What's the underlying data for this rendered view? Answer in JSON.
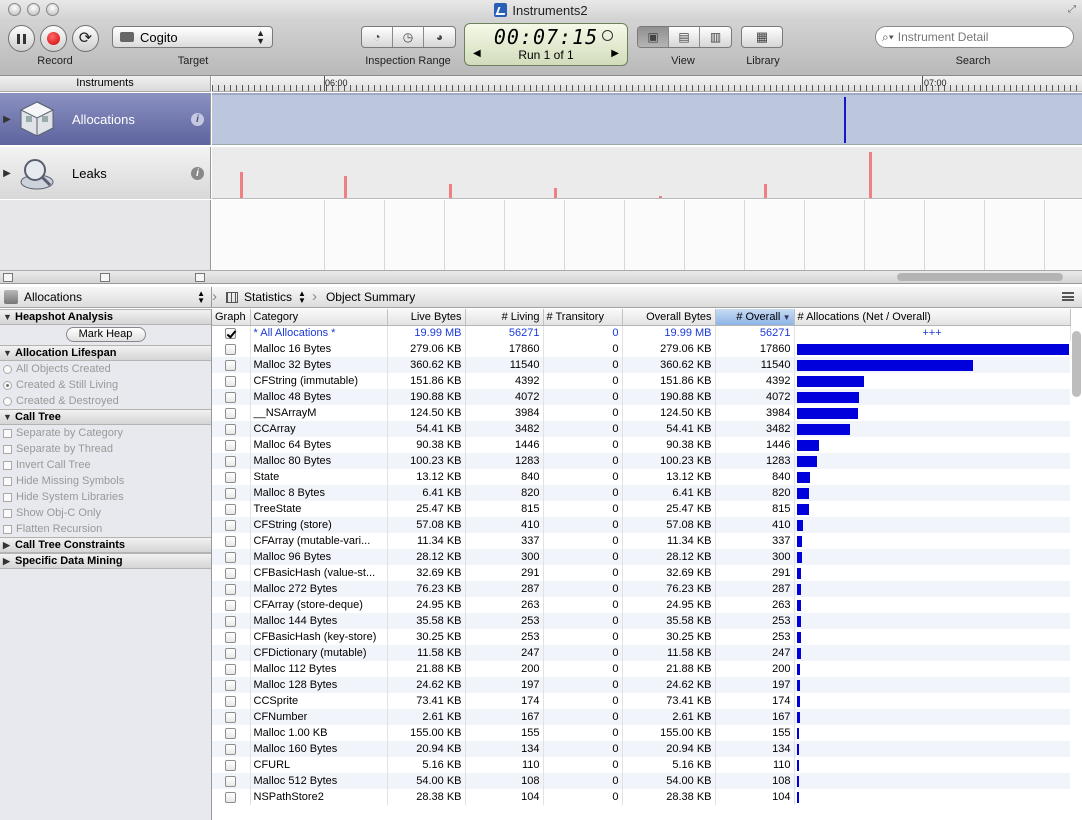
{
  "window": {
    "title": "Instruments2"
  },
  "toolbar": {
    "record_label": "Record",
    "target_label": "Target",
    "target_value": "Cogito",
    "inspection_label": "Inspection Range",
    "timer": "00:07:15",
    "run": "Run 1 of 1",
    "view_label": "View",
    "library_label": "Library",
    "search_label": "Search",
    "search_placeholder": "Instrument Detail"
  },
  "tracks": {
    "header": "Instruments",
    "ruler_labels": [
      "06:00",
      "07:00"
    ],
    "instruments": [
      {
        "name": "Allocations",
        "icon": "allocations-icon"
      },
      {
        "name": "Leaks",
        "icon": "leaks-icon"
      }
    ],
    "leak_spikes": [
      0.55,
      0.45,
      0.3,
      0.2,
      0.05,
      0.3,
      0.95
    ]
  },
  "detail_nav": {
    "instrument": "Allocations",
    "view": "Statistics",
    "breadcrumb": "Object Summary"
  },
  "options": {
    "heapshot": {
      "title": "Heapshot Analysis",
      "button": "Mark Heap"
    },
    "lifespan": {
      "title": "Allocation Lifespan",
      "items": [
        "All Objects Created",
        "Created & Still Living",
        "Created & Destroyed"
      ]
    },
    "calltree": {
      "title": "Call Tree",
      "items": [
        "Separate by Category",
        "Separate by Thread",
        "Invert Call Tree",
        "Hide Missing Symbols",
        "Hide System Libraries",
        "Show Obj-C Only",
        "Flatten Recursion"
      ]
    },
    "constraints": {
      "title": "Call Tree Constraints"
    },
    "datamining": {
      "title": "Specific Data Mining"
    }
  },
  "table": {
    "columns": [
      "Graph",
      "Category",
      "Live Bytes",
      "# Living",
      "# Transitory",
      "Overall Bytes",
      "# Overall",
      "# Allocations (Net / Overall)"
    ],
    "total": {
      "category": "* All Allocations *",
      "live": "19.99 MB",
      "living": "56271",
      "transitory": "0",
      "overall_bytes": "19.99 MB",
      "overall": "56271",
      "graph": "+++"
    },
    "rows": [
      {
        "category": "Malloc 16 Bytes",
        "live": "279.06 KB",
        "living": "17860",
        "transitory": "0",
        "overall_bytes": "279.06 KB",
        "overall": "17860",
        "bar": 17860
      },
      {
        "category": "Malloc 32 Bytes",
        "live": "360.62 KB",
        "living": "11540",
        "transitory": "0",
        "overall_bytes": "360.62 KB",
        "overall": "11540",
        "bar": 11540
      },
      {
        "category": "CFString (immutable)",
        "live": "151.86 KB",
        "living": "4392",
        "transitory": "0",
        "overall_bytes": "151.86 KB",
        "overall": "4392",
        "bar": 4392
      },
      {
        "category": "Malloc 48 Bytes",
        "live": "190.88 KB",
        "living": "4072",
        "transitory": "0",
        "overall_bytes": "190.88 KB",
        "overall": "4072",
        "bar": 4072
      },
      {
        "category": "__NSArrayM",
        "live": "124.50 KB",
        "living": "3984",
        "transitory": "0",
        "overall_bytes": "124.50 KB",
        "overall": "3984",
        "bar": 3984
      },
      {
        "category": "CCArray",
        "live": "54.41 KB",
        "living": "3482",
        "transitory": "0",
        "overall_bytes": "54.41 KB",
        "overall": "3482",
        "bar": 3482
      },
      {
        "category": "Malloc 64 Bytes",
        "live": "90.38 KB",
        "living": "1446",
        "transitory": "0",
        "overall_bytes": "90.38 KB",
        "overall": "1446",
        "bar": 1446
      },
      {
        "category": "Malloc 80 Bytes",
        "live": "100.23 KB",
        "living": "1283",
        "transitory": "0",
        "overall_bytes": "100.23 KB",
        "overall": "1283",
        "bar": 1283
      },
      {
        "category": "State",
        "live": "13.12 KB",
        "living": "840",
        "transitory": "0",
        "overall_bytes": "13.12 KB",
        "overall": "840",
        "bar": 840
      },
      {
        "category": "Malloc 8 Bytes",
        "live": "6.41 KB",
        "living": "820",
        "transitory": "0",
        "overall_bytes": "6.41 KB",
        "overall": "820",
        "bar": 820
      },
      {
        "category": "TreeState",
        "live": "25.47 KB",
        "living": "815",
        "transitory": "0",
        "overall_bytes": "25.47 KB",
        "overall": "815",
        "bar": 815
      },
      {
        "category": "CFString (store)",
        "live": "57.08 KB",
        "living": "410",
        "transitory": "0",
        "overall_bytes": "57.08 KB",
        "overall": "410",
        "bar": 410
      },
      {
        "category": "CFArray (mutable-vari...",
        "live": "11.34 KB",
        "living": "337",
        "transitory": "0",
        "overall_bytes": "11.34 KB",
        "overall": "337",
        "bar": 337
      },
      {
        "category": "Malloc 96 Bytes",
        "live": "28.12 KB",
        "living": "300",
        "transitory": "0",
        "overall_bytes": "28.12 KB",
        "overall": "300",
        "bar": 300
      },
      {
        "category": "CFBasicHash (value-st...",
        "live": "32.69 KB",
        "living": "291",
        "transitory": "0",
        "overall_bytes": "32.69 KB",
        "overall": "291",
        "bar": 291
      },
      {
        "category": "Malloc 272 Bytes",
        "live": "76.23 KB",
        "living": "287",
        "transitory": "0",
        "overall_bytes": "76.23 KB",
        "overall": "287",
        "bar": 287
      },
      {
        "category": "CFArray (store-deque)",
        "live": "24.95 KB",
        "living": "263",
        "transitory": "0",
        "overall_bytes": "24.95 KB",
        "overall": "263",
        "bar": 263
      },
      {
        "category": "Malloc 144 Bytes",
        "live": "35.58 KB",
        "living": "253",
        "transitory": "0",
        "overall_bytes": "35.58 KB",
        "overall": "253",
        "bar": 253
      },
      {
        "category": "CFBasicHash (key-store)",
        "live": "30.25 KB",
        "living": "253",
        "transitory": "0",
        "overall_bytes": "30.25 KB",
        "overall": "253",
        "bar": 253
      },
      {
        "category": "CFDictionary (mutable)",
        "live": "11.58 KB",
        "living": "247",
        "transitory": "0",
        "overall_bytes": "11.58 KB",
        "overall": "247",
        "bar": 247
      },
      {
        "category": "Malloc 112 Bytes",
        "live": "21.88 KB",
        "living": "200",
        "transitory": "0",
        "overall_bytes": "21.88 KB",
        "overall": "200",
        "bar": 200
      },
      {
        "category": "Malloc 128 Bytes",
        "live": "24.62 KB",
        "living": "197",
        "transitory": "0",
        "overall_bytes": "24.62 KB",
        "overall": "197",
        "bar": 197
      },
      {
        "category": "CCSprite",
        "live": "73.41 KB",
        "living": "174",
        "transitory": "0",
        "overall_bytes": "73.41 KB",
        "overall": "174",
        "bar": 174
      },
      {
        "category": "CFNumber",
        "live": "2.61 KB",
        "living": "167",
        "transitory": "0",
        "overall_bytes": "2.61 KB",
        "overall": "167",
        "bar": 167
      },
      {
        "category": "Malloc 1.00 KB",
        "live": "155.00 KB",
        "living": "155",
        "transitory": "0",
        "overall_bytes": "155.00 KB",
        "overall": "155",
        "bar": 155
      },
      {
        "category": "Malloc 160 Bytes",
        "live": "20.94 KB",
        "living": "134",
        "transitory": "0",
        "overall_bytes": "20.94 KB",
        "overall": "134",
        "bar": 134
      },
      {
        "category": "CFURL",
        "live": "5.16 KB",
        "living": "110",
        "transitory": "0",
        "overall_bytes": "5.16 KB",
        "overall": "110",
        "bar": 110
      },
      {
        "category": "Malloc 512 Bytes",
        "live": "54.00 KB",
        "living": "108",
        "transitory": "0",
        "overall_bytes": "54.00 KB",
        "overall": "108",
        "bar": 108
      },
      {
        "category": "NSPathStore2",
        "live": "28.38 KB",
        "living": "104",
        "transitory": "0",
        "overall_bytes": "28.38 KB",
        "overall": "104",
        "bar": 104
      }
    ]
  },
  "colors": {
    "bar": "#0000dd",
    "selection": "#5d649f",
    "leak_spike": "#ef7f82",
    "allocation_spike": "#1818c8"
  }
}
